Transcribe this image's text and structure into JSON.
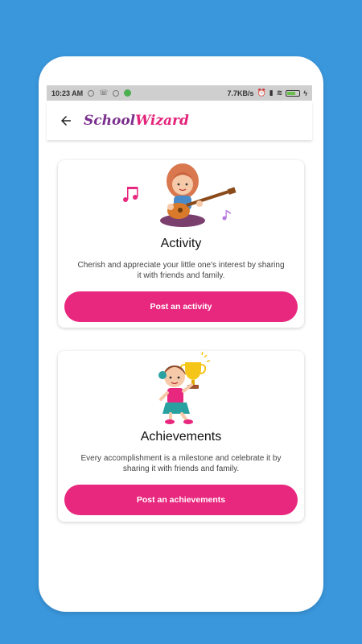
{
  "status_bar": {
    "time": "10:23 AM",
    "net_speed": "7.7KB/s",
    "battery_label": "..."
  },
  "app_bar": {
    "brand_part1": "School",
    "brand_part2": "Wizard"
  },
  "cards": [
    {
      "title": "Activity",
      "description": "Cherish and appreciate your little one's interest by sharing it with friends and family.",
      "button_label": "Post an activity"
    },
    {
      "title": "Achievements",
      "description": "Every accomplishment is a milestone and celebrate it by sharing it with friends and family.",
      "button_label": "Post an achievements"
    }
  ],
  "colors": {
    "background": "#3a97dc",
    "accent_pink": "#e8277e",
    "brand_purple": "#7b2f8e"
  },
  "icons": [
    "back-arrow-icon",
    "music-note-icon",
    "trophy-icon",
    "wifi-icon",
    "battery-icon"
  ]
}
